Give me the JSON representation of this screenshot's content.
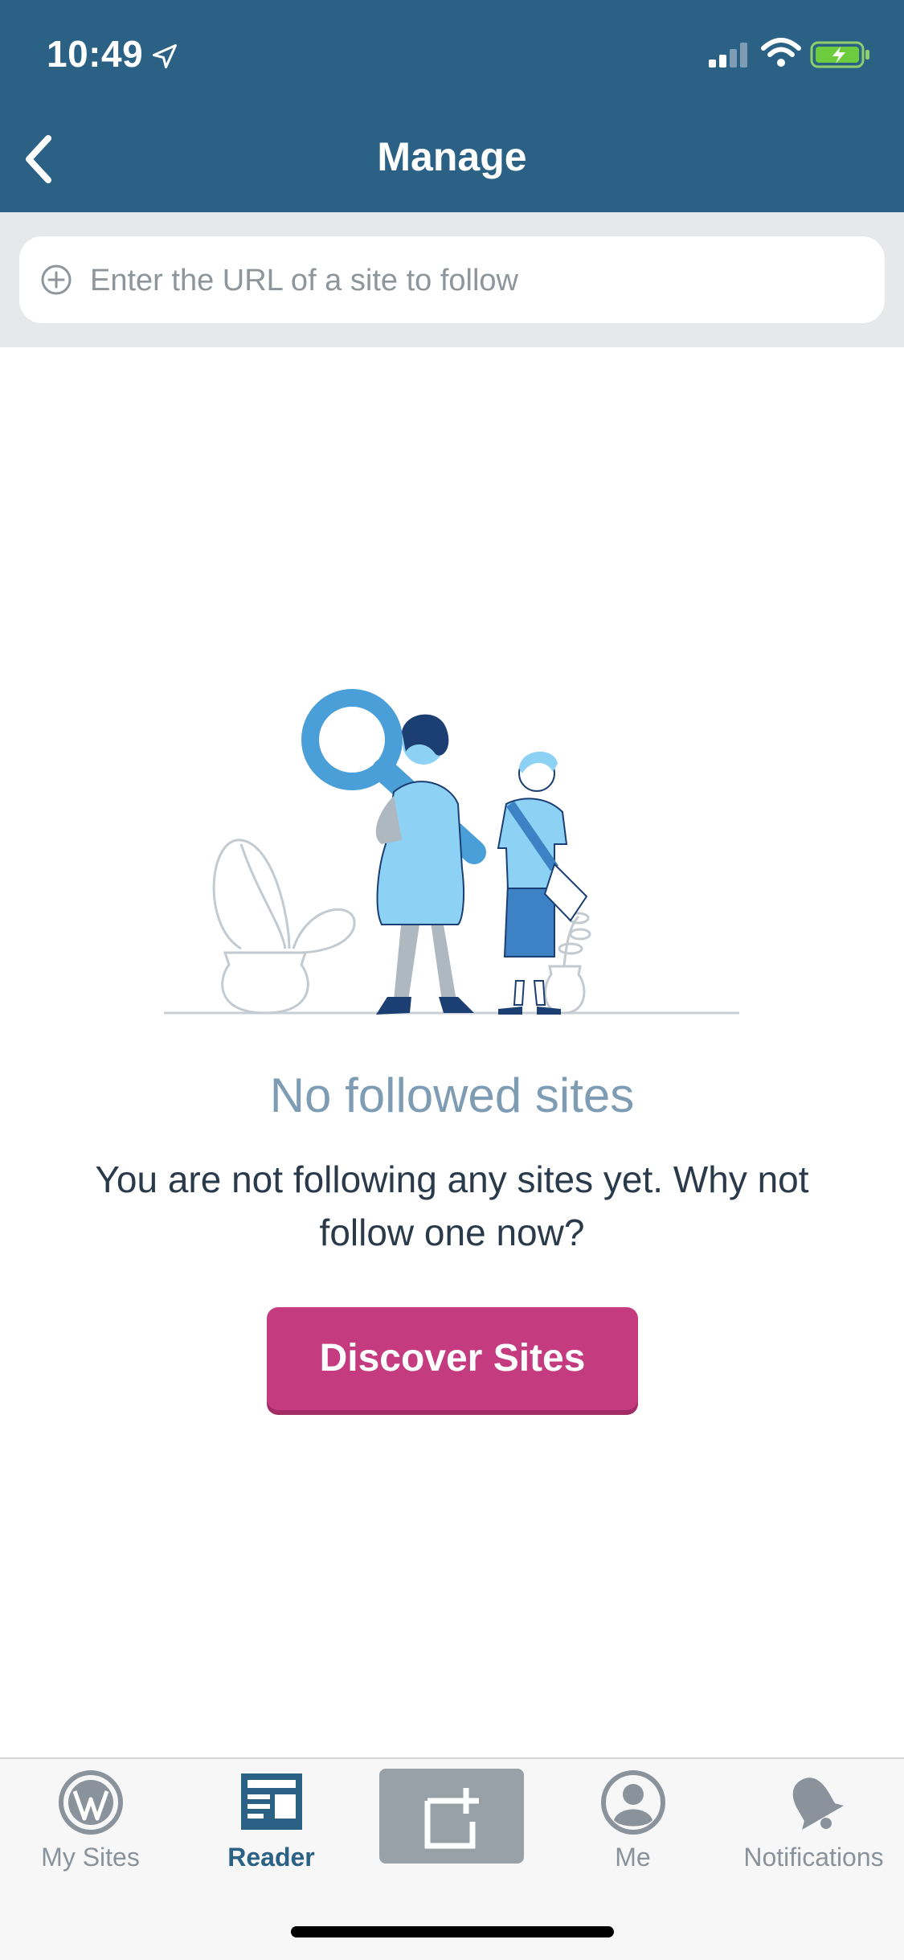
{
  "status_bar": {
    "time": "10:49"
  },
  "nav": {
    "title": "Manage"
  },
  "search": {
    "placeholder": "Enter the URL of a site to follow",
    "value": ""
  },
  "empty_state": {
    "title": "No followed sites",
    "description": "You are not following any sites yet. Why not follow one now?",
    "button_label": "Discover Sites"
  },
  "tabs": [
    {
      "label": "My Sites",
      "icon": "wordpress-icon",
      "active": false
    },
    {
      "label": "Reader",
      "icon": "reader-icon",
      "active": true
    },
    {
      "label": "",
      "icon": "write-post-icon",
      "active": false
    },
    {
      "label": "Me",
      "icon": "person-icon",
      "active": false
    },
    {
      "label": "Notifications",
      "icon": "bell-icon",
      "active": false
    }
  ],
  "colors": {
    "nav_background": "#2b6185",
    "accent_button": "#c53b80",
    "empty_title": "#7e9cb3",
    "tab_active": "#2b6185",
    "tab_inactive": "#8a939b"
  }
}
